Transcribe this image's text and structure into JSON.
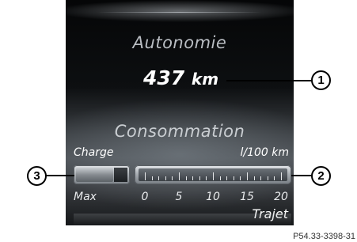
{
  "display": {
    "range": {
      "label": "Autonomie",
      "value": "437",
      "unit": "km"
    },
    "consumption": {
      "label": "Consommation",
      "charge_label": "Charge",
      "unit_label": "l/100 km",
      "charge_level_fraction": 0.72,
      "max_label": "Max",
      "scale_ticks": [
        "0",
        "5",
        "10",
        "15",
        "20"
      ],
      "scale_max": 20,
      "mode_label": "Trajet"
    }
  },
  "callouts": [
    "1",
    "2",
    "3"
  ],
  "figure_reference": "P54.33-3398-31",
  "colors": {
    "screen_background": "#0d0f11",
    "label_text": "#b9bdc2",
    "value_text": "#ffffff"
  }
}
